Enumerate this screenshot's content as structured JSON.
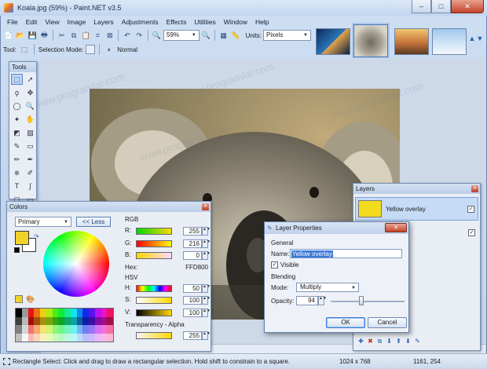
{
  "window": {
    "title": "Koala.jpg (59%) - Paint.NET v3.5",
    "min": "–",
    "max": "□",
    "close": "✕"
  },
  "menu": [
    "File",
    "Edit",
    "View",
    "Image",
    "Layers",
    "Adjustments",
    "Effects",
    "Utilities",
    "Window",
    "Help"
  ],
  "toolbar": {
    "zoom": "59%",
    "units_label": "Units:",
    "units_value": "Pixels"
  },
  "toolbar2": {
    "tool_label": "Tool:",
    "selection_mode_label": "Selection Mode:",
    "blend_value": "Normal"
  },
  "tools_panel": {
    "title": "Tools"
  },
  "colors_panel": {
    "title": "Colors",
    "primary_label": "Primary",
    "less_button": "<< Less",
    "rgb_header": "RGB",
    "r_label": "R:",
    "r_value": "255",
    "g_label": "G:",
    "g_value": "216",
    "b_label": "B:",
    "b_value": "0",
    "hex_label": "Hex:",
    "hex_value": "FFD800",
    "hsv_header": "HSV",
    "h_label": "H:",
    "h_value": "50",
    "s_label": "S:",
    "s_value": "100",
    "v_label": "V:",
    "v_value": "100",
    "alpha_label": "Transparency - Alpha",
    "alpha_value": "255"
  },
  "layers_panel": {
    "title": "Layers",
    "layers": [
      {
        "name": "Yellow overlay",
        "visible": true
      },
      {
        "name": "",
        "visible": true
      }
    ]
  },
  "layer_dialog": {
    "title": "Layer Properties",
    "general_header": "General",
    "name_label": "Name:",
    "name_value": "Yellow overlay",
    "visible_label": "Visible",
    "blending_header": "Blending",
    "mode_label": "Mode:",
    "mode_value": "Multiply",
    "opacity_label": "Opacity:",
    "opacity_value": "94",
    "ok": "OK",
    "cancel": "Cancel"
  },
  "status": {
    "text": "Rectangle Select: Click and drag to draw a rectangular selection. Hold shift to constrain to a square.",
    "image_size": "1024 x 768",
    "cursor_pos": "1161, 254"
  },
  "watermark": "www.programlar.com",
  "colors": {
    "primary": "#F0D22A",
    "accent": "#3B78D8"
  }
}
